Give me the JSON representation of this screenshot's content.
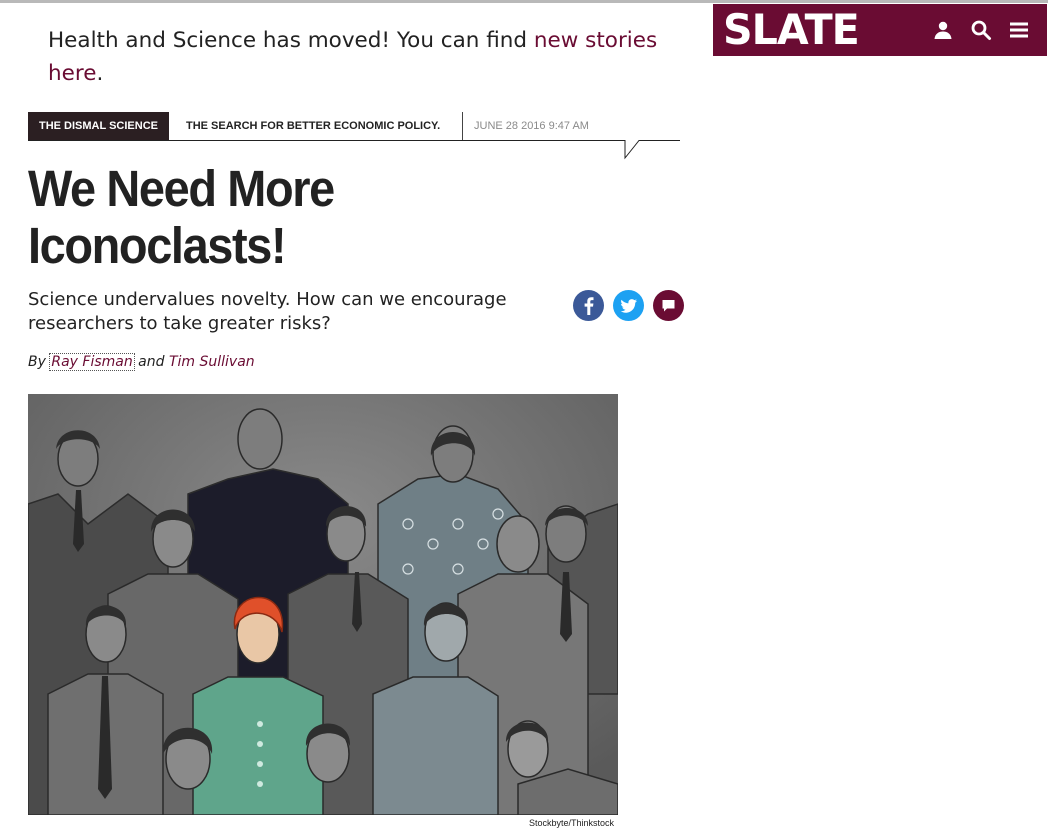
{
  "notice": {
    "text": "Health and Science has moved! You can find ",
    "link_text": "new stories here",
    "end": "."
  },
  "header": {
    "logo": "SLATE",
    "brand_color": "#6a0c33",
    "icons": [
      "user-icon",
      "search-icon",
      "menu-icon"
    ]
  },
  "rubric": {
    "section": "THE DISMAL SCIENCE",
    "tagline": "THE SEARCH FOR BETTER ECONOMIC POLICY.",
    "date": "JUNE 28 2016 9:47 AM"
  },
  "article": {
    "headline_line1": "We Need More",
    "headline_line2": "Iconoclasts!",
    "dek": "Science undervalues novelty. How can we encourage researchers to take greater risks?",
    "byline_prefix": "By",
    "author1": "Ray Fisman",
    "byline_and": "and",
    "author2": "Tim Sullivan",
    "image_credit": "Stockbyte/Thinkstock"
  },
  "share": {
    "facebook_color": "#3b5998",
    "twitter_color": "#1da1f2",
    "comment_color": "#6a0c33"
  }
}
